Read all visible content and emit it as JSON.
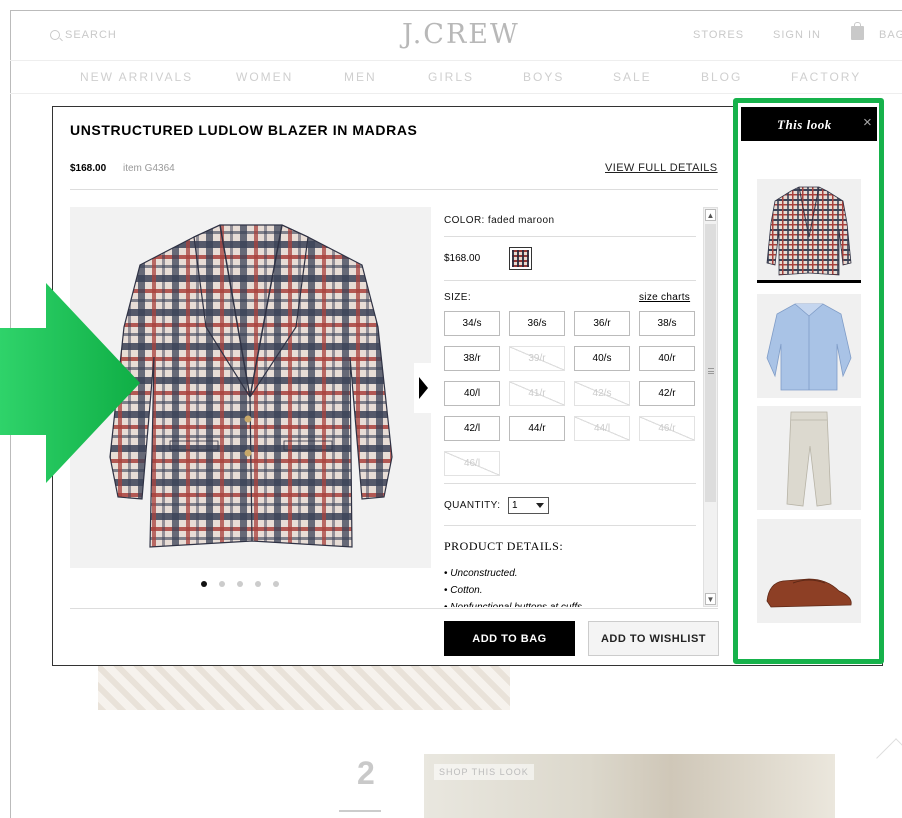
{
  "header": {
    "search_label": "SEARCH",
    "logo": "J.CREW",
    "stores": "STORES",
    "sign_in": "SIGN IN",
    "bag": "BAG"
  },
  "nav": {
    "items": [
      "NEW ARRIVALS",
      "WOMEN",
      "MEN",
      "GIRLS",
      "BOYS",
      "SALE",
      "BLOG",
      "FACTORY"
    ]
  },
  "background": {
    "step_number": "2",
    "shop_label": "SHOP THIS LOOK"
  },
  "product": {
    "title": "UNSTRUCTURED LUDLOW BLAZER IN MADRAS",
    "price": "$168.00",
    "item_number": "item G4364",
    "view_full_details": "VIEW FULL DETAILS",
    "color_label": "COLOR: faded maroon",
    "swatch_price": "$168.00",
    "size_label": "SIZE:",
    "size_charts": "size charts",
    "sizes": [
      {
        "label": "34/s",
        "available": true
      },
      {
        "label": "36/s",
        "available": true
      },
      {
        "label": "36/r",
        "available": true
      },
      {
        "label": "38/s",
        "available": true
      },
      {
        "label": "38/r",
        "available": true
      },
      {
        "label": "39/r",
        "available": false
      },
      {
        "label": "40/s",
        "available": true
      },
      {
        "label": "40/r",
        "available": true
      },
      {
        "label": "40/l",
        "available": true
      },
      {
        "label": "41/r",
        "available": false
      },
      {
        "label": "42/s",
        "available": false
      },
      {
        "label": "42/r",
        "available": true
      },
      {
        "label": "42/l",
        "available": true
      },
      {
        "label": "44/r",
        "available": true
      },
      {
        "label": "44/l",
        "available": false
      },
      {
        "label": "46/r",
        "available": false
      },
      {
        "label": "46/l",
        "available": false
      }
    ],
    "quantity_label": "QUANTITY:",
    "quantity_value": "1",
    "details_heading": "PRODUCT DETAILS:",
    "details": [
      "Unconstructed.",
      "Cotton.",
      "Nonfunctional buttons at cuffs."
    ],
    "image_count": 5,
    "active_image": 1,
    "add_to_bag": "ADD TO BAG",
    "add_to_wishlist": "ADD TO WISHLIST"
  },
  "look_panel": {
    "title": "This look",
    "close_glyph": "×",
    "items": [
      {
        "icon": "blazer-thumbnail",
        "selected": true
      },
      {
        "icon": "shirt-thumbnail",
        "selected": false
      },
      {
        "icon": "chinos-thumbnail",
        "selected": false
      },
      {
        "icon": "loafer-thumbnail",
        "selected": false
      }
    ],
    "highlight_color": "#16b24b"
  },
  "colors": {
    "annotation_green": "#16b24b",
    "primary_button": "#000000"
  }
}
